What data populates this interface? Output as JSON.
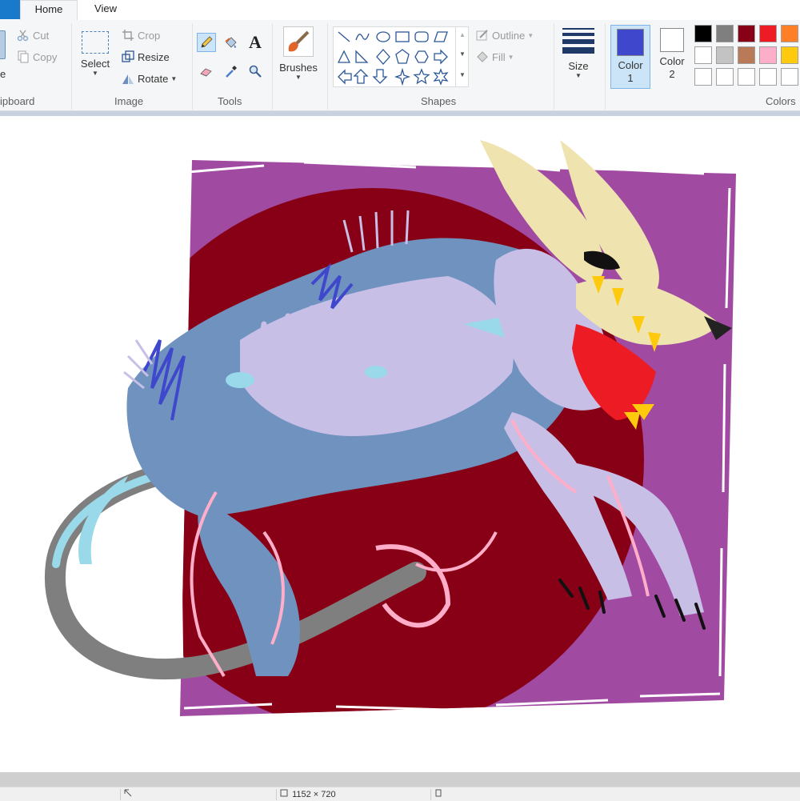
{
  "tabs": {
    "home": "Home",
    "view": "View"
  },
  "clipboard": {
    "paste_label": "e",
    "cut": "Cut",
    "copy": "Copy",
    "group": "ipboard"
  },
  "image": {
    "select": "Select",
    "crop": "Crop",
    "resize": "Resize",
    "rotate": "Rotate",
    "group": "Image"
  },
  "tools": {
    "group": "Tools",
    "text_glyph": "A",
    "active_tool": "pencil"
  },
  "brushes": {
    "label": "Brushes"
  },
  "shapes": {
    "group": "Shapes",
    "outline": "Outline",
    "fill": "Fill"
  },
  "size": {
    "label": "Size"
  },
  "colors": {
    "color1_label": "Color",
    "color1_num": "1",
    "color1_value": "#3f48cc",
    "color2_label": "Color",
    "color2_num": "2",
    "color2_value": "#ffffff",
    "group": "Colors",
    "palette_row1": [
      "#000000",
      "#7f7f7f",
      "#880015",
      "#ed1c24",
      "#ff7f27"
    ],
    "palette_row2": [
      "#ffffff",
      "#c3c3c3",
      "#b97a57",
      "#ffaec9",
      "#ffc90e"
    ],
    "palette_row3": [
      "#ffffff",
      "#ffffff",
      "#ffffff",
      "#ffffff",
      "#ffffff"
    ]
  },
  "status": {
    "dimensions": "1152 × 720"
  },
  "artwork": {
    "background": "#a04aa2",
    "circle": "#880015",
    "body": "#6f92bf",
    "highlight": "#c8bfe7",
    "light_blue": "#99d9ea",
    "pink": "#ffaec9",
    "ear_cream": "#efe4b0",
    "tail_gray": "#7f7f7f",
    "mouth_red": "#ed1c24",
    "teeth_yellow": "#ffc90e",
    "stroke_blue": "#3f48cc"
  }
}
